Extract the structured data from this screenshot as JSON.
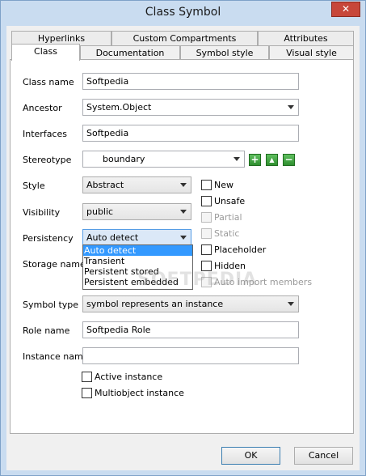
{
  "window": {
    "title": "Class Symbol",
    "close_glyph": "✕"
  },
  "tabs": {
    "row1": [
      "Hyperlinks",
      "Custom Compartments",
      "Attributes"
    ],
    "row2": [
      "Class",
      "Documentation",
      "Symbol style",
      "Visual style"
    ],
    "active": "Class"
  },
  "form": {
    "class_name": {
      "label": "Class name",
      "value": "Softpedia"
    },
    "ancestor": {
      "label": "Ancestor",
      "value": "System.Object"
    },
    "interfaces": {
      "label": "Interfaces",
      "value": "Softpedia"
    },
    "stereotype": {
      "label": "Stereotype",
      "value": "boundary",
      "add": "+",
      "up": "▲",
      "remove": "−"
    },
    "style": {
      "label": "Style",
      "value": "Abstract"
    },
    "visibility": {
      "label": "Visibility",
      "value": "public"
    },
    "persistency": {
      "label": "Persistency",
      "value": "Auto detect",
      "options": [
        "Auto detect",
        "Transient",
        "Persistent stored",
        "Persistent embedded"
      ]
    },
    "storage_name": {
      "label": "Storage name"
    },
    "symbol_type": {
      "label": "Symbol type",
      "value": "symbol represents an instance"
    },
    "role_name": {
      "label": "Role name",
      "value": "Softpedia Role"
    },
    "instance_name": {
      "label": "Instance name",
      "value": ""
    },
    "flags": {
      "new": "New",
      "unsafe": "Unsafe",
      "partial": "Partial",
      "static": "Static",
      "placeholder": "Placeholder",
      "hidden": "Hidden",
      "auto_import": "Auto import members"
    },
    "active_instance": "Active instance",
    "multiobject_instance": "Multiobject instance"
  },
  "buttons": {
    "ok": "OK",
    "cancel": "Cancel"
  },
  "watermark": "SOFTPEDIA"
}
